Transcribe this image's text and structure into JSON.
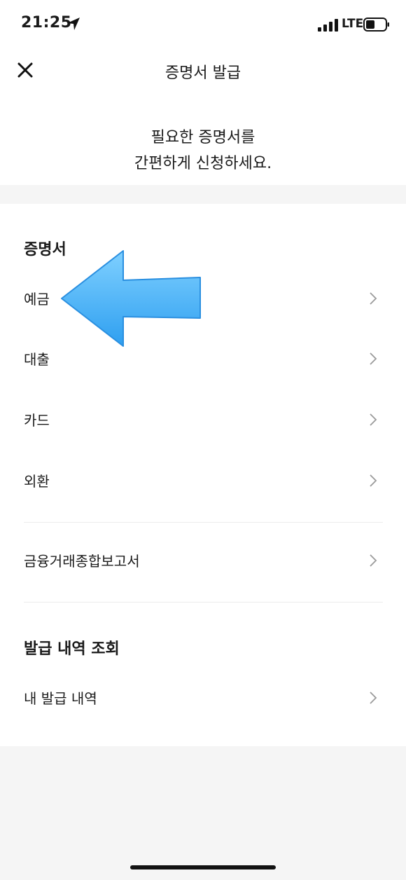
{
  "status_bar": {
    "time": "21:25",
    "network": "LTE",
    "location_icon": "location-arrow-icon",
    "signal_icon": "signal-bars-icon",
    "battery_icon": "battery-icon"
  },
  "nav": {
    "title": "증명서 발급",
    "close_icon": "close-icon"
  },
  "intro": {
    "line1": "필요한 증명서를",
    "line2": "간편하게 신청하세요."
  },
  "certificates": {
    "heading": "증명서",
    "items": [
      {
        "label": "예금"
      },
      {
        "label": "대출"
      },
      {
        "label": "카드"
      },
      {
        "label": "외환"
      }
    ],
    "report": {
      "label": "금융거래종합보고서"
    }
  },
  "history": {
    "heading": "발급 내역 조회",
    "items": [
      {
        "label": "내 발급 내역"
      }
    ]
  },
  "colors": {
    "background": "#f5f5f5",
    "surface": "#ffffff",
    "text": "#1a1a1a",
    "chevron": "#9a9a9a",
    "annotation_arrow": "#4ab4f5"
  }
}
